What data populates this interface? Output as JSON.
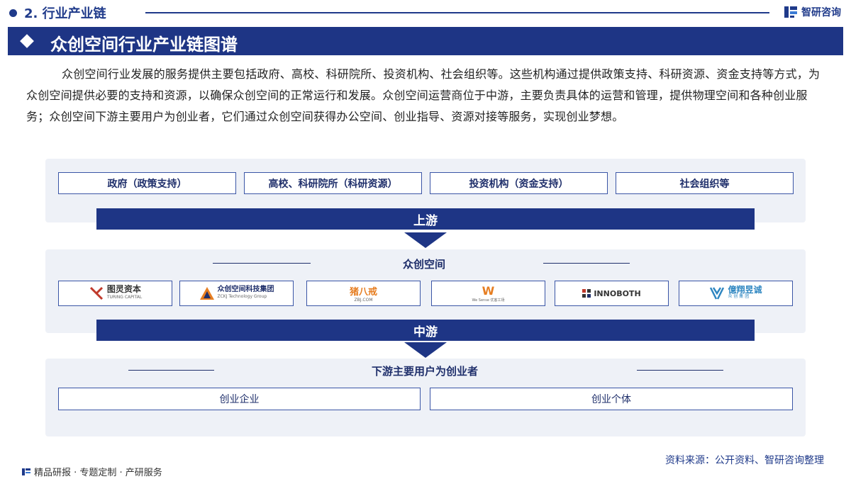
{
  "header": {
    "section_label": "2. 行业产业链",
    "brand": "智研咨询"
  },
  "title": "众创空间行业产业链图谱",
  "intro": "众创空间行业发展的服务提供主要包括政府、高校、科研院所、投资机构、社会组织等。这些机构通过提供政策支持、科研资源、资金支持等方式，为众创空间提供必要的支持和资源，以确保众创空间的正常运行和发展。众创空间运营商位于中游，主要负责具体的运营和管理，提供物理空间和各种创业服务；众创空间下游主要用户为创业者，它们通过众创空间获得办公空间、创业指导、资源对接等服务，实现创业梦想。",
  "upstream": {
    "boxes": [
      "政府（政策支持）",
      "高校、科研院所（科研资源）",
      "投资机构（资金支持）",
      "社会组织等"
    ],
    "stage_label": "上游"
  },
  "midstream": {
    "title": "众创空间",
    "logos": [
      {
        "name": "图灵资本",
        "sub": "TURING  CAPITAL",
        "color": "#c0392b"
      },
      {
        "name": "众创空间科技集团",
        "sub": "ZCKJ Technology Group",
        "color": "#1f2f6b"
      },
      {
        "name": "猪八戒",
        "sub": "ZBJ.COM",
        "color": "#e67e22"
      },
      {
        "name": "W",
        "sub": "We Sense 优客工场",
        "color": "#e67e22"
      },
      {
        "name": "INNOBOTH",
        "sub": "",
        "color": "#333333"
      },
      {
        "name": "億翔昱诚",
        "sub": "众 创 集 团",
        "color": "#2e86c1"
      }
    ],
    "stage_label": "中游"
  },
  "downstream": {
    "title": "下游主要用户为创业者",
    "boxes": [
      "创业企业",
      "创业个体"
    ]
  },
  "footer": {
    "source": "资料来源：公开资料、智研咨询整理",
    "tagline": "精品研报 · 专题定制 · 产研服务"
  },
  "colors": {
    "primary": "#1e3585",
    "panel_bg": "#eef1f7",
    "box_border": "#3a55a6"
  }
}
